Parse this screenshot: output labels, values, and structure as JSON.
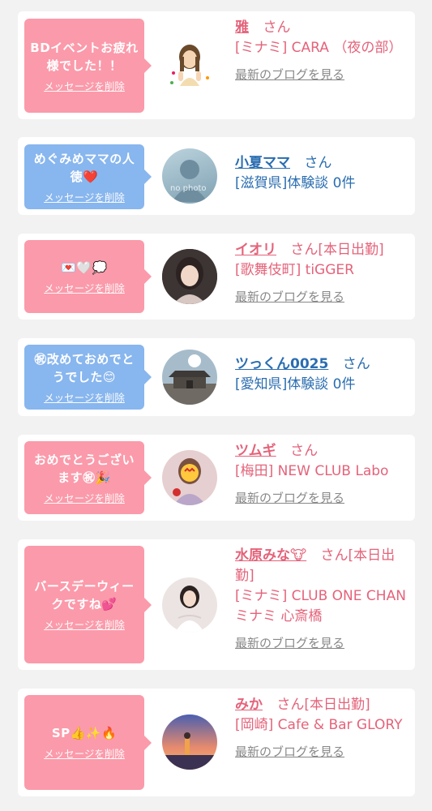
{
  "messages": [
    {
      "bubble_color": "pink",
      "message": "BDイベントお疲れ様でした！！",
      "delete_label": "メッセージを削除",
      "name": "雅",
      "honorific": "さん",
      "status": "",
      "shop": "[ミナミ] CARA （夜の部）",
      "blog_link": "最新のブログを見る",
      "avatar_icon": "woman-cartoon-avatar"
    },
    {
      "bubble_color": "blue",
      "message": "めぐみめママの人徳",
      "message_emoji": "❤️",
      "delete_label": "メッセージを削除",
      "name": "小夏ママ",
      "honorific": "さん",
      "status": "",
      "shop": "[滋賀県]体験談 0件",
      "blog_link": "",
      "avatar_icon": "no-photo-avatar",
      "avatar_text": "no photo"
    },
    {
      "bubble_color": "pink",
      "message": "💌🤍💭",
      "delete_label": "メッセージを削除",
      "name": "イオリ",
      "honorific": "さん",
      "status": "[本日出勤]",
      "shop": "[歌舞伎町] tiGGER",
      "blog_link": "最新のブログを見る",
      "avatar_icon": "girl-photo-avatar"
    },
    {
      "bubble_color": "blue",
      "message": "㊗改めておめでとうでした😊",
      "delete_label": "メッセージを削除",
      "name": "ツっくん0025",
      "honorific": "さん",
      "status": "",
      "shop": "[愛知県]体験談 0件",
      "blog_link": "",
      "avatar_icon": "temple-photo-avatar"
    },
    {
      "bubble_color": "pink",
      "message": "おめでとうございます㊗🎉",
      "delete_label": "メッセージを削除",
      "name": "ツムギ",
      "honorific": "さん",
      "status": "",
      "shop": "[梅田] NEW CLUB Labo",
      "blog_link": "最新のブログを見る",
      "avatar_icon": "girl-photo-avatar-2"
    },
    {
      "bubble_color": "pink",
      "message": "バースデーウィークですね💕",
      "delete_label": "メッセージを削除",
      "name": "水原みな🐮",
      "honorific": "さん",
      "status": "[本日出勤]",
      "shop": "[ミナミ] CLUB ONE CHAN ミナミ 心斎橋",
      "blog_link": "最新のブログを見る",
      "avatar_icon": "girl-photo-avatar-3"
    },
    {
      "bubble_color": "pink",
      "message": "SP👍✨🔥",
      "delete_label": "メッセージを削除",
      "name": "みか",
      "honorific": "さん",
      "status": "[本日出勤]",
      "shop": "[岡崎] Cafe & Bar GLORY",
      "blog_link": "最新のブログを見る",
      "avatar_icon": "sunset-photo-avatar"
    }
  ],
  "colors": {
    "pink_bubble": "#fb9aaa",
    "blue_bubble": "#88b6ee",
    "pink_text": "#e4637a",
    "blue_text": "#2a6db0"
  }
}
